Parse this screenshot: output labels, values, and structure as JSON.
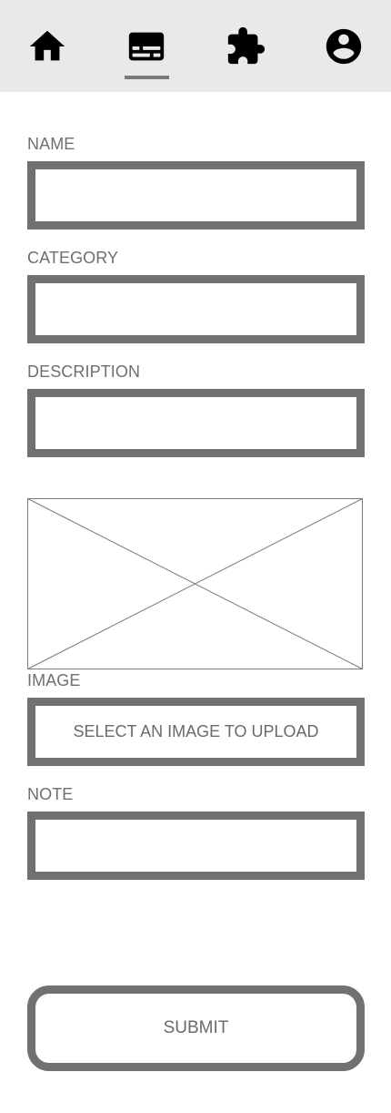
{
  "nav": {
    "items": [
      {
        "icon": "home-icon",
        "active": false
      },
      {
        "icon": "forms-icon",
        "active": true
      },
      {
        "icon": "puzzle-icon",
        "active": false
      },
      {
        "icon": "account-icon",
        "active": false
      }
    ]
  },
  "form": {
    "name_label": "NAME",
    "name_value": "",
    "category_label": "CATEGORY",
    "category_value": "",
    "description_label": "DESCRIPTION",
    "description_value": "",
    "image_label": "IMAGE",
    "upload_label": "SELECT AN IMAGE TO UPLOAD",
    "note_label": "NOTE",
    "note_value": "",
    "submit_label": "SUBMIT"
  },
  "colors": {
    "nav_background": "#e9e9e9",
    "border": "#717171",
    "text": "#6b6b6b"
  }
}
